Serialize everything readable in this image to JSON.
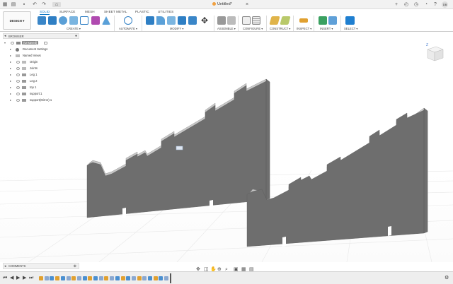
{
  "titlebar": {
    "document_title": "Untitled*",
    "avatar_initials": "DB"
  },
  "ribbon": {
    "workspace_label": "DESIGN ▾",
    "tabs": [
      "SOLID",
      "SURFACE",
      "MESH",
      "SHEET METAL",
      "PLASTIC",
      "UTILITIES"
    ],
    "active_tab": "SOLID",
    "groups": [
      "CREATE ▾",
      "AUTOMATE ▾",
      "MODIFY ▾",
      "ASSEMBLE ▾",
      "CONFIGURE ▾",
      "CONSTRUCT ▾",
      "INSPECT ▾",
      "INSERT ▾",
      "SELECT ▾"
    ],
    "accent_color": "#0b76c4"
  },
  "browser": {
    "header": "BROWSER",
    "root": "(Unsaved)",
    "items": [
      "Document Settings",
      "Named Views",
      "Origin",
      "Joints",
      "Leg 1",
      "Leg 2",
      "top 1",
      "support:1",
      "support(Mirror):1"
    ]
  },
  "comments": {
    "header": "COMMENTS"
  },
  "timeline": {
    "playback_icons": [
      "first-icon",
      "prev-icon",
      "play-icon",
      "next-icon",
      "last-icon"
    ],
    "feature_count": 24
  }
}
